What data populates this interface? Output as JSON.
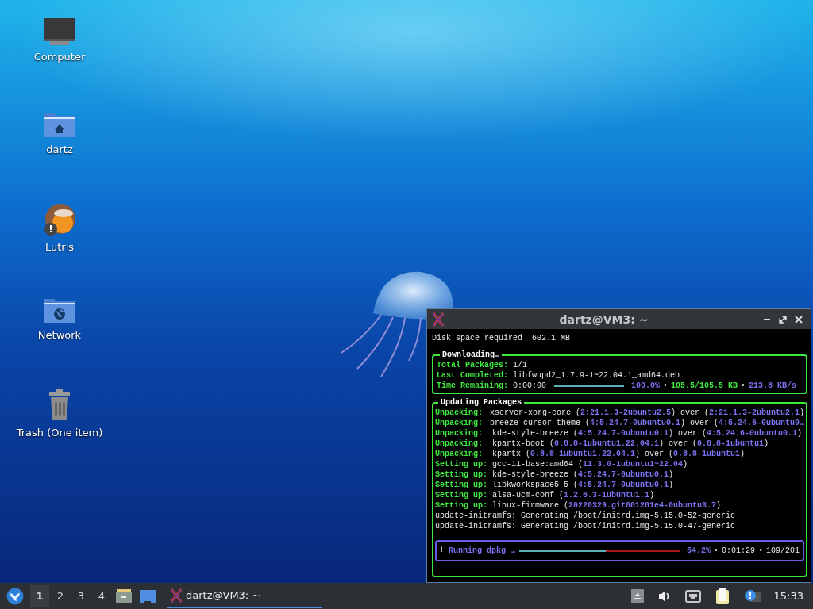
{
  "desktop": {
    "icons": [
      {
        "label": "Computer",
        "kind": "computer"
      },
      {
        "label": "dartz",
        "kind": "home-folder"
      },
      {
        "label": "Lutris",
        "kind": "lutris"
      },
      {
        "label": "Network",
        "kind": "network-folder"
      },
      {
        "label": "Trash (One item)",
        "kind": "trash"
      }
    ]
  },
  "terminal": {
    "title": "dartz@VM3: ~",
    "header": "Disk space required  602.1 MB",
    "download": {
      "title": "Downloading…",
      "rows": [
        {
          "label": "Total Packages:",
          "value": "1/1"
        },
        {
          "label": "Last Completed:",
          "value": "libfwupd2_1.7.9-1~22.04.1_amd64.deb"
        }
      ],
      "progress": {
        "label": "Time Remaining:",
        "value": "0:00:00",
        "level": 1.0,
        "stats": [
          {
            "text": "100.0%",
            "kind": "accent"
          },
          {
            "text": "•",
            "kind": "plain"
          },
          {
            "text": "105.5/105.5 KB",
            "kind": "good"
          },
          {
            "text": "•",
            "kind": "plain"
          },
          {
            "text": "213.8 KB/s",
            "kind": "accent"
          }
        ]
      }
    },
    "updating": {
      "title": "Updating Packages",
      "lines": [
        {
          "kind": "status",
          "label": "Unpacking:",
          "text": "xserver-xorg-core (**2:21.1.3-2ubuntu2.5**) over (**2:21.1.3-2ubuntu2.1**)"
        },
        {
          "kind": "status",
          "label": "Unpacking:",
          "text": "breeze-cursor-theme (**4:5.24.7-0ubuntu0.1**) over (**4:5.24.6-0ubuntu0…**"
        },
        {
          "kind": "status",
          "label": "Unpacking:",
          "text": "kde-style-breeze (**4:5.24.7-0ubuntu0.1**) over (**4:5.24.6-0ubuntu0.1**)"
        },
        {
          "kind": "status",
          "label": "Unpacking:",
          "text": "kpartx-boot (**0.8.8-1ubuntu1.22.04.1**) over (**0.8.8-1ubuntu1**)"
        },
        {
          "kind": "status",
          "label": "Unpacking:",
          "text": "kpartx (**0.8.8-1ubuntu1.22.04.1**) over (**0.8.8-1ubuntu1**)"
        },
        {
          "kind": "status",
          "label": "Setting up:",
          "text": "gcc-11-base:amd64 (**11.3.0-1ubuntu1~22.04**)"
        },
        {
          "kind": "status",
          "label": "Setting up:",
          "text": "kde-style-breeze (**4:5.24.7-0ubuntu0.1**)"
        },
        {
          "kind": "status",
          "label": "Setting up:",
          "text": "libkworkspace5-5 (**4:5.24.7-0ubuntu0.1**)"
        },
        {
          "kind": "status",
          "label": "Setting up:",
          "text": "alsa-ucm-conf (**1.2.6.3-1ubuntu1.1**)"
        },
        {
          "kind": "status",
          "label": "Setting up:",
          "text": "linux-firmware (**20220329.git681281e4-0ubuntu3.7**)"
        },
        {
          "kind": "plain",
          "text": "update-initramfs: Generating /boot/initrd.img-5.15.0-52-generic"
        },
        {
          "kind": "plain",
          "text": "update-initramfs: Generating /boot/initrd.img-5.15.0-47-generic"
        }
      ],
      "running": {
        "spinner": "⠇",
        "label": "Running dpkg …",
        "level": 0.542,
        "stats": [
          {
            "text": "54.2%",
            "kind": "accent"
          },
          {
            "text": "•",
            "kind": "plain"
          },
          {
            "text": "0:01:29",
            "kind": "plain"
          },
          {
            "text": "•",
            "kind": "plain"
          },
          {
            "text": "109/201",
            "kind": "plain"
          }
        ]
      }
    }
  },
  "taskbar": {
    "workspaces": [
      {
        "label": "1",
        "selected": true
      },
      {
        "label": "2",
        "selected": false
      },
      {
        "label": "3",
        "selected": false
      },
      {
        "label": "4",
        "selected": false
      }
    ],
    "tasks": [
      {
        "title": "dartz@VM3: ~",
        "selected": true
      }
    ],
    "clock": "15:33"
  }
}
